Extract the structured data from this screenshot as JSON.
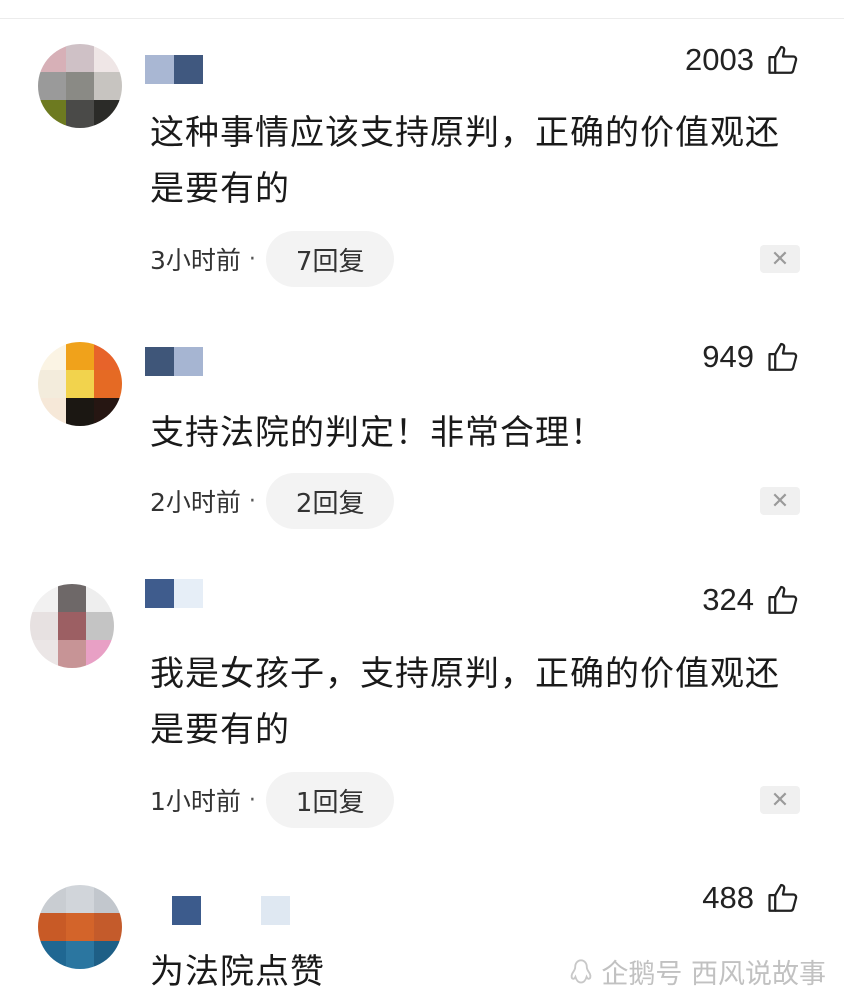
{
  "comments": [
    {
      "likes": "2003",
      "text": "这种事情应该支持原判，正确的价值观还是要有的",
      "time": "3小时前",
      "replies": "7回复",
      "close": "✕"
    },
    {
      "likes": "949",
      "text": "支持法院的判定！非常合理！",
      "time": "2小时前",
      "replies": "2回复",
      "close": "✕"
    },
    {
      "likes": "324",
      "text": "我是女孩子，支持原判，正确的价值观还是要有的",
      "time": "1小时前",
      "replies": "1回复",
      "close": "✕"
    },
    {
      "likes": "488",
      "text": "为法院点赞"
    }
  ],
  "watermark": {
    "text": "企鹅号 西风说故事"
  },
  "icons": {
    "like": "thumbs-up-icon",
    "close": "close-icon",
    "watermark": "penguin-logo-icon"
  },
  "meta_separator": "·"
}
